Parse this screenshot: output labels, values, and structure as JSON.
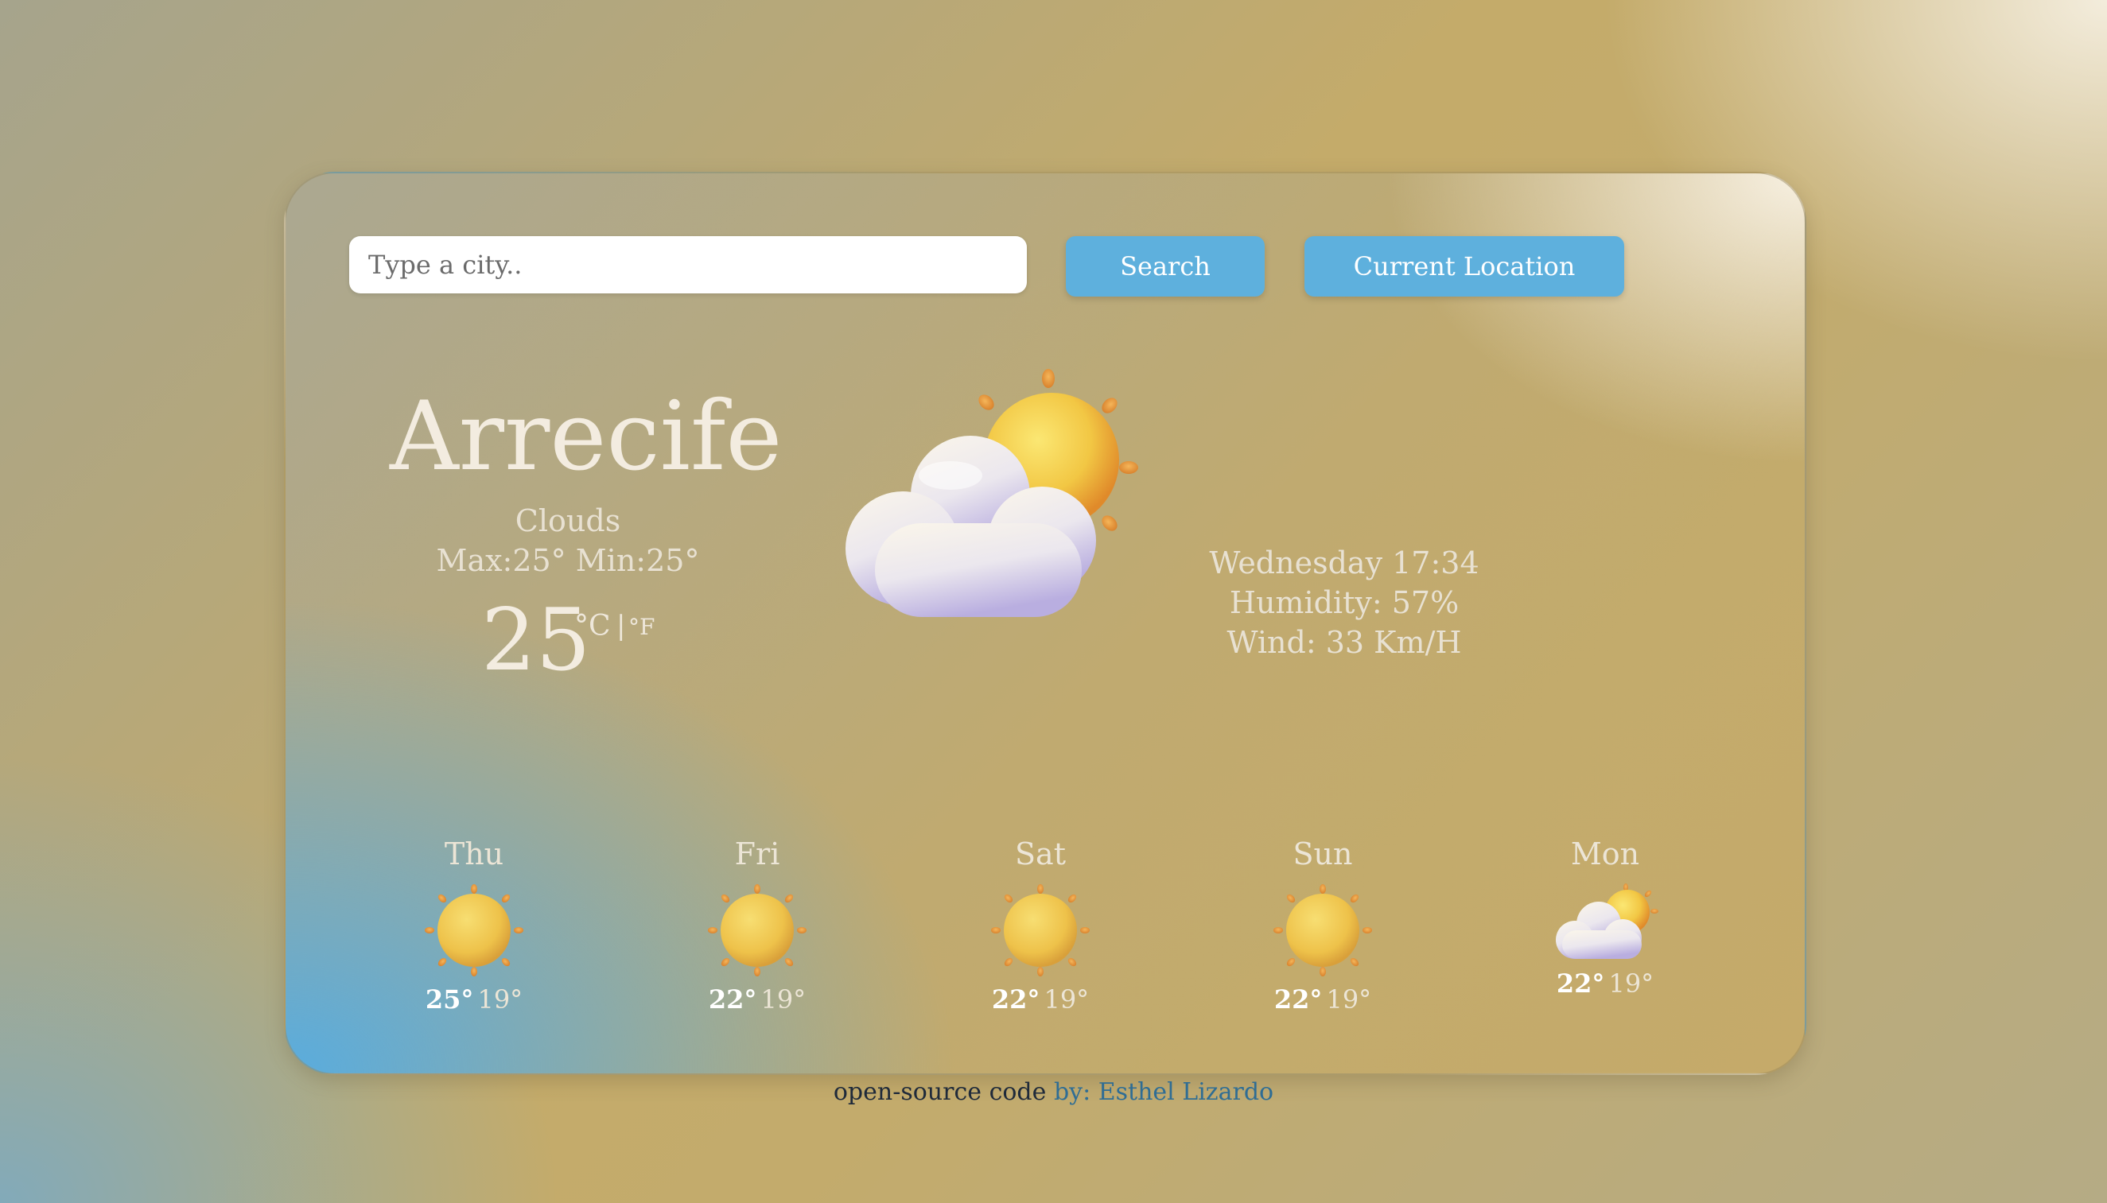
{
  "search": {
    "placeholder": "Type a city..",
    "value": ""
  },
  "buttons": {
    "search_label": "Search",
    "current_location_label": "Current Location"
  },
  "current": {
    "city": "Arrecife",
    "description": "Clouds",
    "max_min": "Max:25° Min:25°",
    "temperature": "25",
    "unit_celsius": "°C",
    "unit_separator": "|",
    "unit_fahrenheit": "°F",
    "icon": "sun-behind-cloud-icon",
    "date_time": "Wednesday 17:34",
    "humidity": "Humidity: 57%",
    "wind": "Wind: 33 Km/H"
  },
  "forecast": [
    {
      "day": "Thu",
      "max": "25°",
      "min": "19°",
      "icon": "sun-icon"
    },
    {
      "day": "Fri",
      "max": "22°",
      "min": "19°",
      "icon": "sun-icon"
    },
    {
      "day": "Sat",
      "max": "22°",
      "min": "19°",
      "icon": "sun-icon"
    },
    {
      "day": "Sun",
      "max": "22°",
      "min": "19°",
      "icon": "sun-icon"
    },
    {
      "day": "Mon",
      "max": "22°",
      "min": "19°",
      "icon": "sun-behind-cloud-icon"
    }
  ],
  "footer": {
    "text": "open-source code",
    "link_text": "by: Esthel Lizardo"
  },
  "colors": {
    "button": "#5eb0dd",
    "title_text": "#f3ece0",
    "card_accent_blue": "#54ace3",
    "background_gold": "#c4ab6a"
  }
}
